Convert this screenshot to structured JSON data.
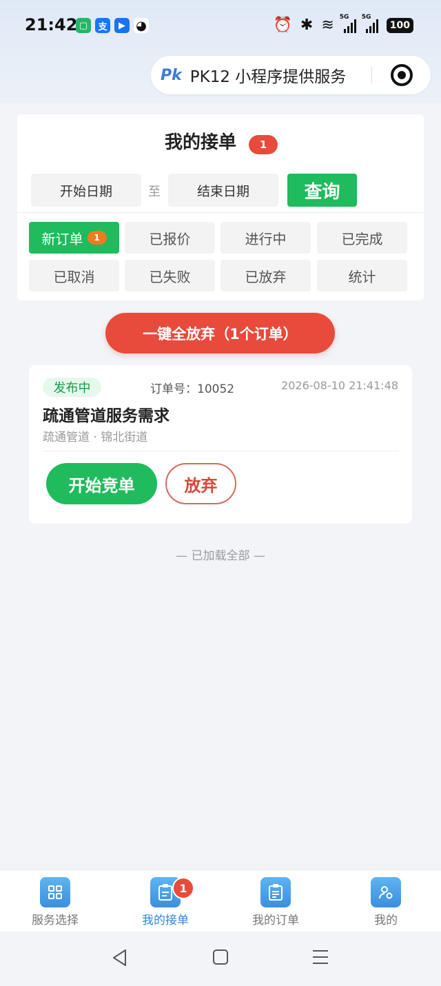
{
  "status_bar": {
    "time": "21:42",
    "apps": [
      {
        "icon": "phone-manager-icon",
        "glyph": "▢",
        "color": "#22b866"
      },
      {
        "icon": "alipay-icon",
        "glyph": "支",
        "color": "#1677ff"
      },
      {
        "icon": "play-icon",
        "glyph": "▶",
        "color": "#1a73e8"
      },
      {
        "icon": "qq-icon",
        "glyph": "◕",
        "color": "#111111"
      }
    ],
    "alarm": "⏰",
    "bluetooth": "✱",
    "wifi": "≋",
    "signal1_tag": "5G",
    "signal2_tag": "5G",
    "battery": "100"
  },
  "capsule": {
    "logo": "Pk",
    "title": "PK12 小程序提供服务"
  },
  "header": {
    "title": "我的接单",
    "badge": "1",
    "date_start": "开始日期",
    "date_sep": "至",
    "date_end": "结束日期",
    "query_label": "查询"
  },
  "tabs": [
    {
      "label": "新订单",
      "badge": "1",
      "active": true
    },
    {
      "label": "已报价"
    },
    {
      "label": "进行中"
    },
    {
      "label": "已完成"
    },
    {
      "label": "已取消"
    },
    {
      "label": "已失败"
    },
    {
      "label": "已放弃"
    },
    {
      "label": "统计"
    }
  ],
  "abandon_all_label": "一键全放弃（1个订单）",
  "order": {
    "status": "发布中",
    "order_no": "订单号：10052",
    "time": "2026-08-10 21:41:48",
    "title": "疏通管道服务需求",
    "subtitle": "疏通管道 · 锦北街道",
    "bid_label": "开始竞单",
    "giveup_label": "放弃"
  },
  "loaded_all": "— 已加载全部 —",
  "bottom_nav": [
    {
      "label": "服务选择"
    },
    {
      "label": "我的接单",
      "badge": "1",
      "active": true
    },
    {
      "label": "我的订单"
    },
    {
      "label": "我的"
    }
  ],
  "colors": {
    "primary_green": "#1fbb5c",
    "danger_red": "#e84a3b",
    "active_blue": "#2f86dc"
  }
}
